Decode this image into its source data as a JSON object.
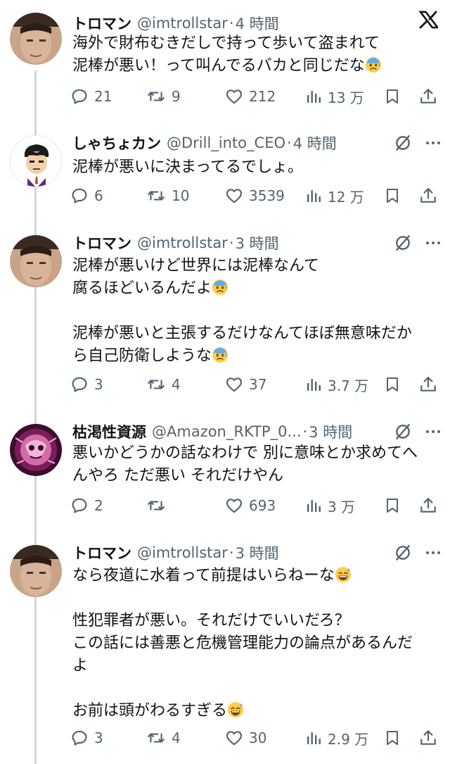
{
  "colors": {
    "text": "#0f1419",
    "muted": "#536471",
    "line": "#cfd9de"
  },
  "logo": "x-logo-icon",
  "posts": [
    {
      "name": "トロマン",
      "handle": "@imtrollstar",
      "time": "4 時間",
      "paragraphs": [
        "海外で財布むきだしで持って歩いて盗まれて",
        "泥棒が悪い！って叫んでるバカと同じだな"
      ],
      "emoji": "anxious-face-icon",
      "reply": "21",
      "retweet": "9",
      "like": "212",
      "views": "13 万"
    },
    {
      "name": "しゃちょカン",
      "handle": "@Drill_into_CEO",
      "time": "4 時間",
      "paragraphs": [
        "泥棒が悪いに決まってるでしょ。"
      ],
      "reply": "6",
      "retweet": "10",
      "like": "3539",
      "views": "12 万"
    },
    {
      "name": "トロマン",
      "handle": "@imtrollstar",
      "time": "3 時間",
      "paragraphs": [
        "泥棒が悪いけど世界には泥棒なんて\n腐るほどいるんだよ",
        "泥棒が悪いと主張するだけなんてほぼ無意味だか\nら自己防衛しような"
      ],
      "reply": "3",
      "retweet": "4",
      "like": "37",
      "views": "3.7 万"
    },
    {
      "name": "枯渇性資源",
      "handle": "@Amazon_RKTP_0...",
      "time": "3 時間",
      "paragraphs": [
        "悪いかどうかの話なわけで 別に意味とか求めてへ\nんやろ ただ悪い それだけやん"
      ],
      "reply": "2",
      "retweet": "",
      "like": "693",
      "views": "3 万"
    },
    {
      "name": "トロマン",
      "handle": "@imtrollstar",
      "time": "3 時間",
      "paragraphs": [
        "なら夜道に水着って前提はいらねーな",
        "性犯罪者が悪い。それだけでいいだろ？\nこの話には善悪と危機管理能力の論点があるんだ\nよ",
        "お前は頭がわるすぎる"
      ],
      "reply": "3",
      "retweet": "4",
      "like": "30",
      "views": "2.9 万"
    }
  ]
}
